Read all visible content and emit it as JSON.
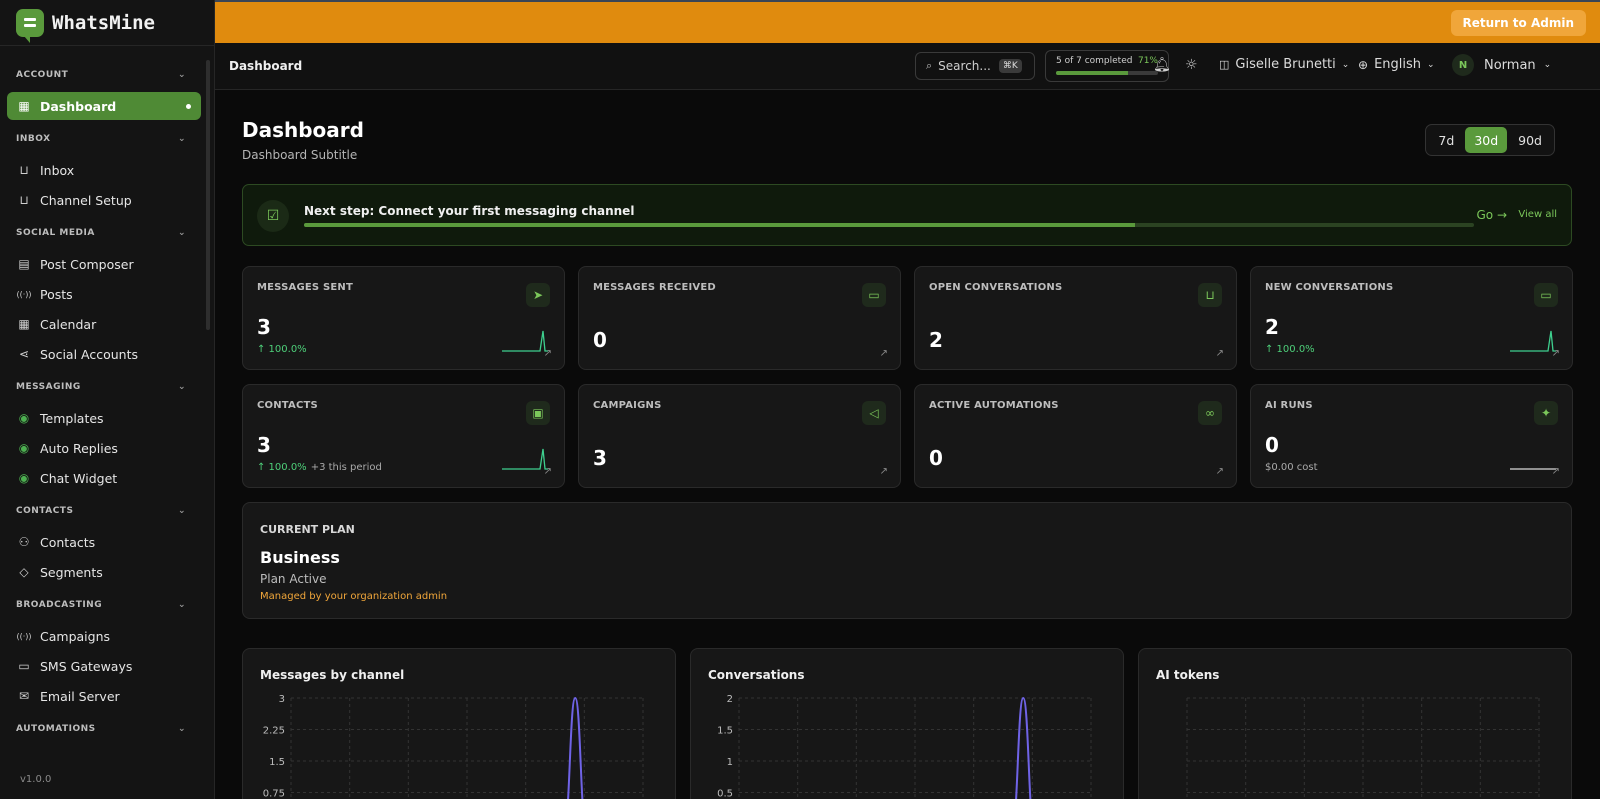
{
  "brand": {
    "name": "WhatsMine"
  },
  "sidebar": {
    "sections": [
      {
        "title": "ACCOUNT",
        "items": [
          {
            "label": "Dashboard",
            "icon": "grid-icon",
            "active": true
          }
        ]
      },
      {
        "title": "INBOX",
        "items": [
          {
            "label": "Inbox",
            "icon": "inbox-icon"
          },
          {
            "label": "Channel Setup",
            "icon": "inbox-icon"
          }
        ]
      },
      {
        "title": "SOCIAL MEDIA",
        "items": [
          {
            "label": "Post Composer",
            "icon": "document-icon"
          },
          {
            "label": "Posts",
            "icon": "broadcast-icon"
          },
          {
            "label": "Calendar",
            "icon": "grid-icon"
          },
          {
            "label": "Social Accounts",
            "icon": "share-icon"
          }
        ]
      },
      {
        "title": "MESSAGING",
        "items": [
          {
            "label": "Templates",
            "icon": "whatsapp-icon"
          },
          {
            "label": "Auto Replies",
            "icon": "whatsapp-icon"
          },
          {
            "label": "Chat Widget",
            "icon": "whatsapp-icon"
          }
        ]
      },
      {
        "title": "CONTACTS",
        "items": [
          {
            "label": "Contacts",
            "icon": "users-icon"
          },
          {
            "label": "Segments",
            "icon": "tag-icon"
          }
        ]
      },
      {
        "title": "BROADCASTING",
        "items": [
          {
            "label": "Campaigns",
            "icon": "broadcast-icon"
          },
          {
            "label": "SMS Gateways",
            "icon": "message-icon"
          },
          {
            "label": "Email Server",
            "icon": "mail-icon"
          }
        ]
      },
      {
        "title": "AUTOMATIONS",
        "items": []
      }
    ],
    "version": "v1.0.0"
  },
  "banner": {
    "return_label": "Return to Admin"
  },
  "header": {
    "breadcrumb": "Dashboard",
    "search_placeholder": "Search...",
    "search_shortcut": "⌘K",
    "progress_text": "5 of 7 completed",
    "progress_pct": "71%",
    "progress_value": 0.71,
    "workspace": "Giselle Brunetti",
    "language": "English",
    "user_initial": "N",
    "user_name": "Norman"
  },
  "page": {
    "title": "Dashboard",
    "subtitle": "Dashboard Subtitle",
    "ranges": [
      "7d",
      "30d",
      "90d"
    ],
    "active_range": "30d"
  },
  "next_step": {
    "title": "Next step: Connect your first messaging channel",
    "progress_value": 0.71,
    "go_label": "Go →",
    "view_all_label": "View all"
  },
  "stats": [
    {
      "label": "MESSAGES SENT",
      "value": "3",
      "change": "↑ 100.0%",
      "extra": "",
      "sub": "",
      "icon": "send-icon",
      "spark": true
    },
    {
      "label": "MESSAGES RECEIVED",
      "value": "0",
      "change": "",
      "extra": "",
      "sub": "",
      "icon": "chat-icon",
      "spark": false
    },
    {
      "label": "OPEN CONVERSATIONS",
      "value": "2",
      "change": "",
      "extra": "",
      "sub": "",
      "icon": "inbox-icon",
      "spark": false
    },
    {
      "label": "NEW CONVERSATIONS",
      "value": "2",
      "change": "↑ 100.0%",
      "extra": "",
      "sub": "",
      "icon": "chat-icon",
      "spark": true
    },
    {
      "label": "CONTACTS",
      "value": "3",
      "change": "↑ 100.0%",
      "extra": "+3 this period",
      "sub": "",
      "icon": "contact-card-icon",
      "spark": true
    },
    {
      "label": "CAMPAIGNS",
      "value": "3",
      "change": "",
      "extra": "",
      "sub": "",
      "icon": "megaphone-icon",
      "spark": false
    },
    {
      "label": "ACTIVE AUTOMATIONS",
      "value": "0",
      "change": "",
      "extra": "",
      "sub": "",
      "icon": "workflow-icon",
      "spark": false
    },
    {
      "label": "AI RUNS",
      "value": "0",
      "change": "",
      "extra": "",
      "sub": "$0.00 cost",
      "icon": "sparkles-icon",
      "spark": "flat"
    }
  ],
  "plan": {
    "label": "CURRENT PLAN",
    "name": "Business",
    "status": "Plan Active",
    "managed": "Managed by your organization admin"
  },
  "charts": [
    {
      "title": "Messages by channel"
    },
    {
      "title": "Conversations"
    },
    {
      "title": "AI tokens"
    }
  ],
  "chart_data": [
    {
      "type": "line",
      "title": "Messages by channel",
      "yticks": [
        "3",
        "2.25",
        "1.5",
        "0.75"
      ],
      "ylim": [
        0,
        3
      ],
      "series": [
        {
          "values": [
            0,
            0,
            0,
            0,
            0,
            0,
            0,
            0,
            0,
            0,
            0,
            0,
            0,
            0,
            0,
            0,
            0,
            0,
            0,
            0,
            0,
            0,
            0,
            0,
            0,
            0,
            3,
            0,
            0,
            0
          ]
        }
      ],
      "color": "#6f63e6"
    },
    {
      "type": "line",
      "title": "Conversations",
      "yticks": [
        "2",
        "1.5",
        "1",
        "0.5"
      ],
      "ylim": [
        0,
        2
      ],
      "series": [
        {
          "values": [
            0,
            0,
            0,
            0,
            0,
            0,
            0,
            0,
            0,
            0,
            0,
            0,
            0,
            0,
            0,
            0,
            0,
            0,
            0,
            0,
            0,
            0,
            0,
            0,
            0,
            0,
            2,
            0,
            0,
            0
          ]
        }
      ],
      "color": "#6f63e6"
    },
    {
      "type": "line",
      "title": "AI tokens",
      "yticks": [],
      "series": [
        {
          "values": []
        }
      ]
    }
  ]
}
